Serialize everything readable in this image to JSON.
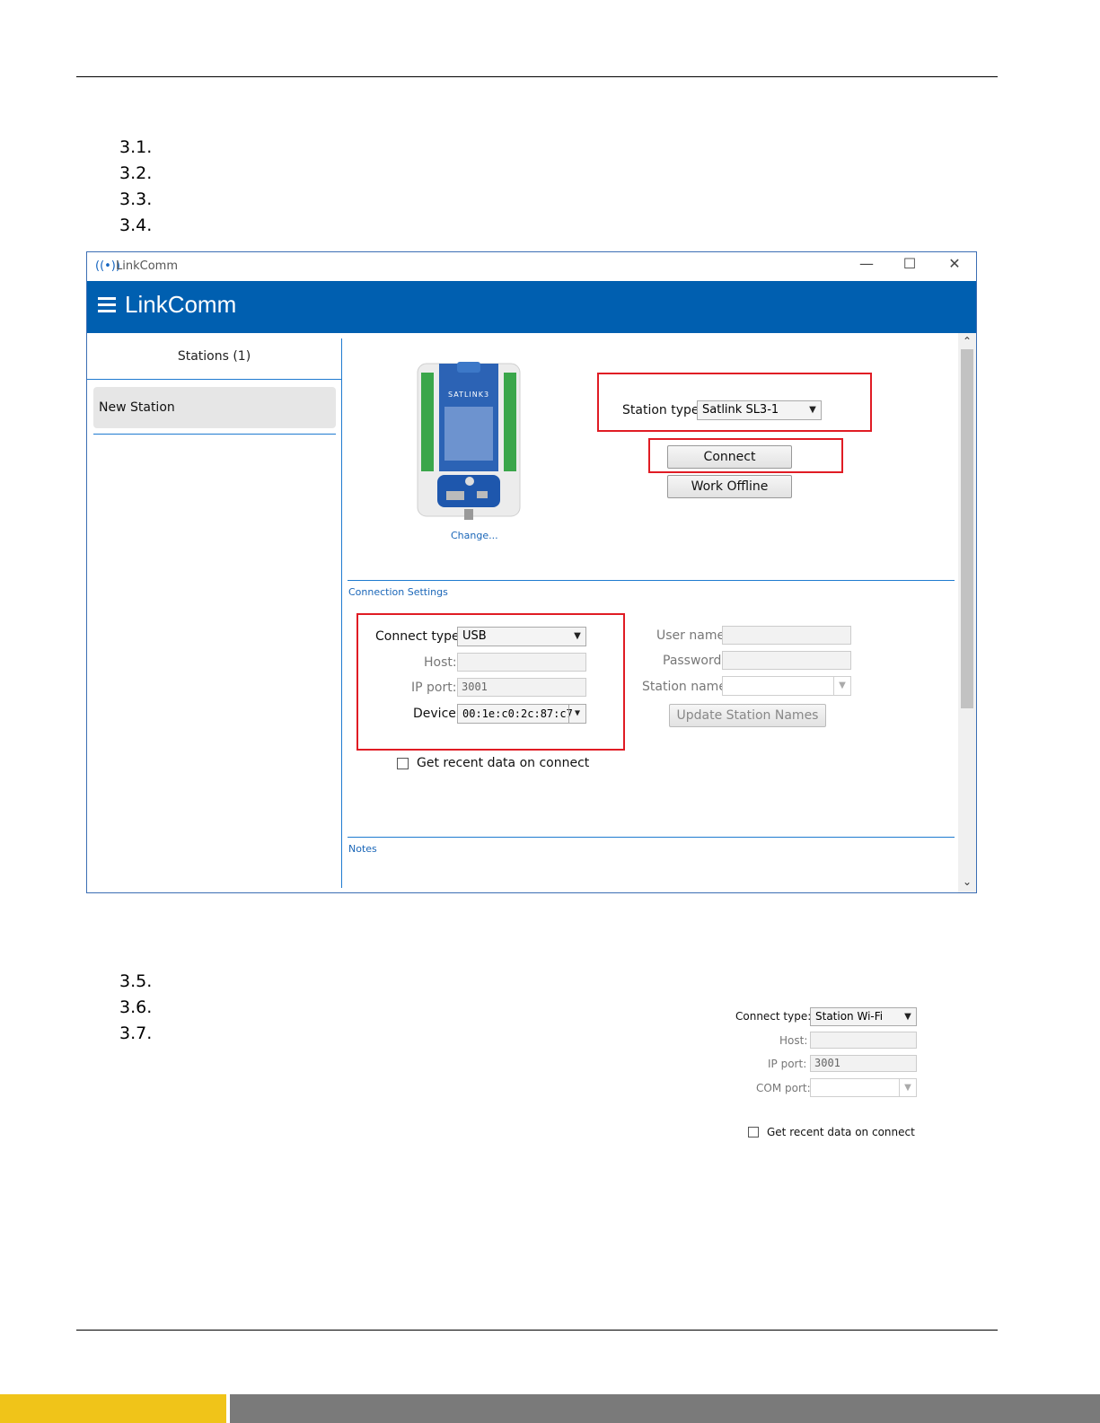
{
  "steps_top": [
    "3.1.",
    "3.2.",
    "3.3.",
    "3.4."
  ],
  "steps_bottom": [
    "3.5.",
    "3.6.",
    "3.7."
  ],
  "window": {
    "title": "LinkComm",
    "app_title": "LinkComm",
    "minimize": "—",
    "maximize": "☐",
    "close": "✕"
  },
  "sidebar": {
    "header": "Stations (1)",
    "items": [
      {
        "label": "New Station"
      }
    ]
  },
  "device": {
    "brand": "SATLINK3",
    "change_link": "Change..."
  },
  "station": {
    "type_label": "Station type:",
    "type_value": "Satlink SL3-1",
    "connect": "Connect",
    "work_offline": "Work Offline"
  },
  "connection": {
    "section_title": "Connection Settings",
    "connect_type_label": "Connect type:",
    "connect_type_value": "USB",
    "host_label": "Host:",
    "host_value": "",
    "ip_port_label": "IP port:",
    "ip_port_value": "3001",
    "device_label": "Device:",
    "device_value": "00:1e:c0:2c:87:c7",
    "user_label": "User name:",
    "password_label": "Password:",
    "station_name_label": "Station name:",
    "update_button": "Update Station Names",
    "recent_data": "Get recent data on connect"
  },
  "notes": {
    "section_title": "Notes"
  },
  "wifi_panel": {
    "connect_type_label": "Connect type:",
    "connect_type_value": "Station Wi-Fi",
    "host_label": "Host:",
    "ip_port_label": "IP port:",
    "ip_port_value": "3001",
    "com_port_label": "COM port:",
    "recent_data": "Get recent data on connect"
  },
  "colors": {
    "appbar": "#005fb0",
    "highlight": "#e01c24",
    "footer_yellow": "#f0c419",
    "footer_gray": "#7a7a7a"
  }
}
